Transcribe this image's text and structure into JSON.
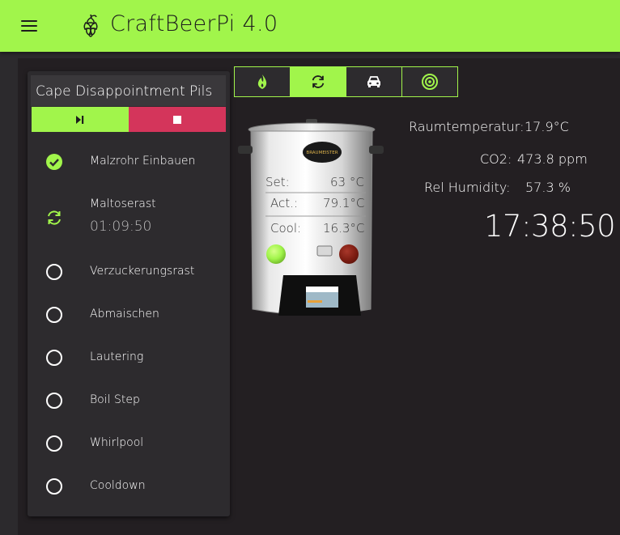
{
  "app": {
    "title": "CraftBeerPi 4.0"
  },
  "colors": {
    "accent": "#a1f54b",
    "stop": "#d4355b",
    "panel": "#2d2b2e",
    "background": "#231f22"
  },
  "recipe": {
    "name": "Cape Disappointment Pils",
    "controls": {
      "start_icon": "play-pause-icon",
      "stop_icon": "stop-icon"
    }
  },
  "steps": [
    {
      "label": "Malzrohr Einbauen",
      "status": "done",
      "icon": "check-circle-icon"
    },
    {
      "label": "Maltoserast",
      "status": "active",
      "icon": "sync-icon",
      "timer": "01:09:50"
    },
    {
      "label": "Verzuckerungsrast",
      "status": "pending",
      "icon": "circle-icon"
    },
    {
      "label": "Abmaischen",
      "status": "pending",
      "icon": "circle-icon"
    },
    {
      "label": "Lautering",
      "status": "pending",
      "icon": "circle-icon"
    },
    {
      "label": "Boil Step",
      "status": "pending",
      "icon": "circle-icon"
    },
    {
      "label": "Whirlpool",
      "status": "pending",
      "icon": "circle-icon"
    },
    {
      "label": "Cooldown",
      "status": "pending",
      "icon": "circle-icon"
    }
  ],
  "toolbar": [
    {
      "icon": "flame-icon",
      "active": false
    },
    {
      "icon": "sync-icon",
      "active": true
    },
    {
      "icon": "car-icon",
      "active": false
    },
    {
      "icon": "target-icon",
      "active": true
    }
  ],
  "kettle": {
    "brand": "BRAUMEISTER",
    "set_label": "Set:",
    "set_value": "63 °C",
    "act_label": "Act.:",
    "act_value": "79.1°C",
    "cool_label": "Cool:",
    "cool_value": "16.3°C",
    "heater_indicator_color": "#a1f54b",
    "cooler_indicator_color": "#7a1b10"
  },
  "sensors": {
    "room_label": "Raumtemperatur:",
    "room_value": "17.9°C",
    "co2_label": "CO2:",
    "co2_value": "473.8 ppm",
    "humidity_label": "Rel Humidity:",
    "humidity_value": "57.3 %"
  },
  "clock": "17:38:50"
}
